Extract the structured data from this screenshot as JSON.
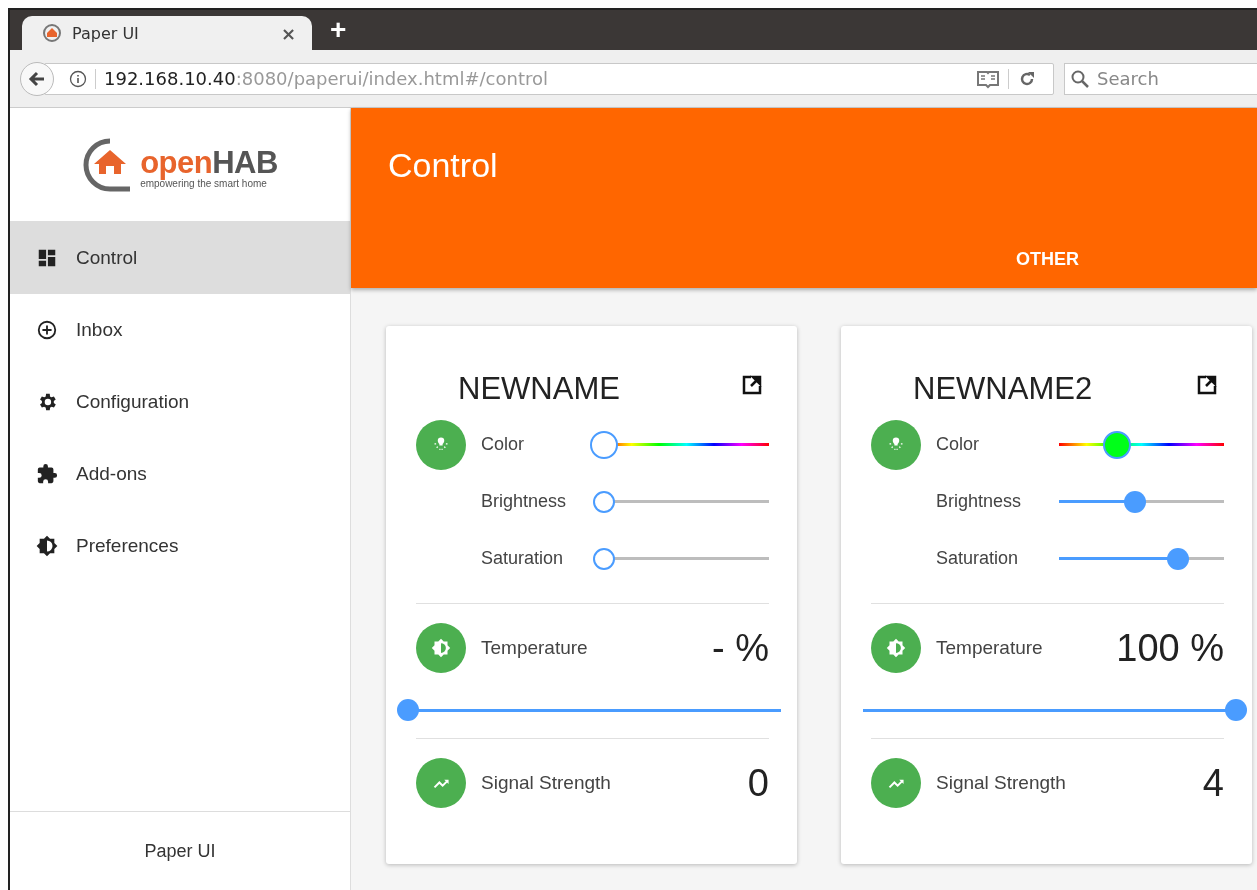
{
  "browser": {
    "tab_title": "Paper UI",
    "tab_close": "×",
    "new_tab": "+",
    "url": {
      "host": "192.168.10.40",
      "path": ":8080/paperui/index.html#/control"
    },
    "search": {
      "placeholder": "Search"
    }
  },
  "logo": {
    "wordmark": [
      "open",
      "HAB"
    ],
    "tagline": "empowering the smart home"
  },
  "sidebar": {
    "items": [
      {
        "kind": "dashboard",
        "label": "Control",
        "selected": true
      },
      {
        "kind": "inbox",
        "label": "Inbox",
        "selected": false
      },
      {
        "kind": "configuration",
        "label": "Configuration",
        "selected": false
      },
      {
        "kind": "addons",
        "label": "Add-ons",
        "selected": false
      },
      {
        "kind": "preferences",
        "label": "Preferences",
        "selected": false
      }
    ],
    "footer": "Paper UI"
  },
  "header": {
    "title": "Control",
    "tabs": [
      "OTHER"
    ]
  },
  "cards": [
    {
      "title": "NEWNAME",
      "color": {
        "label": "Color",
        "level": 0
      },
      "sliders": [
        {
          "label": "Brightness",
          "level": 0
        },
        {
          "label": "Saturation",
          "level": 0
        }
      ],
      "temperature": {
        "label": "Temperature",
        "reading": "- %",
        "level": 0
      },
      "signal": {
        "label": "Signal Strength",
        "reading": "0"
      }
    },
    {
      "title": "NEWNAME2",
      "color": {
        "label": "Color",
        "level": 0.35
      },
      "sliders": [
        {
          "label": "Brightness",
          "level": 0.46
        },
        {
          "label": "Saturation",
          "level": 0.72
        }
      ],
      "temperature": {
        "label": "Temperature",
        "reading": "100 %",
        "level": 1
      },
      "signal": {
        "label": "Signal Strength",
        "reading": "4"
      }
    }
  ]
}
